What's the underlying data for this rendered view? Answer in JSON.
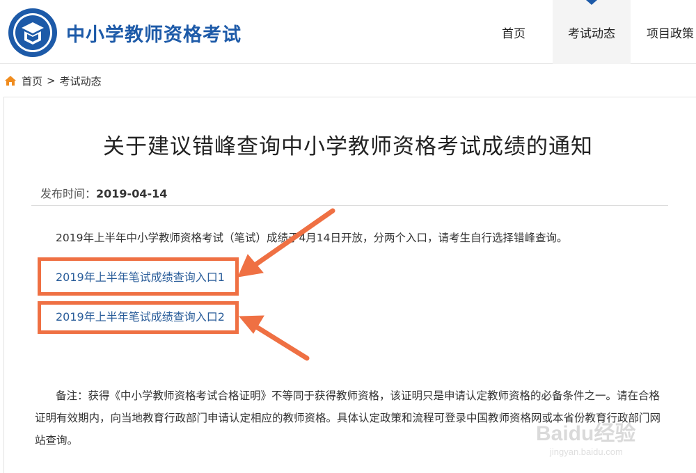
{
  "header": {
    "site_title": "中小学教师资格考试",
    "nav": [
      {
        "label": "首页",
        "active": false
      },
      {
        "label": "考试动态",
        "active": true
      },
      {
        "label": "项目政策",
        "active": false
      }
    ]
  },
  "breadcrumb": {
    "home": "首页",
    "separator": ">",
    "current": "考试动态"
  },
  "article": {
    "title": "关于建议错峰查询中小学教师资格考试成绩的通知",
    "meta_label": "发布时间：",
    "date": "2019-04-14",
    "intro": "2019年上半年中小学教师资格考试（笔试）成绩于4月14日开放，分两个入口，请考生自行选择错峰查询。",
    "links": [
      "2019年上半年笔试成绩查询入口1",
      "2019年上半年笔试成绩查询入口2"
    ],
    "note": "备注：获得《中小学教师资格考试合格证明》不等同于获得教师资格，该证明只是申请认定教师资格的必备条件之一。请在合格证明有效期内，向当地教育行政部门申请认定相应的教师资格。具体认定政策和流程可登录中国教师资格网或本省份教育行政部门网站查询。"
  },
  "colors": {
    "brand": "#1d5aa8",
    "link": "#2a5d9a",
    "highlight": "#ef7043"
  },
  "watermark": {
    "main": "Baidu经验",
    "sub": "jingyan.baidu.com"
  }
}
